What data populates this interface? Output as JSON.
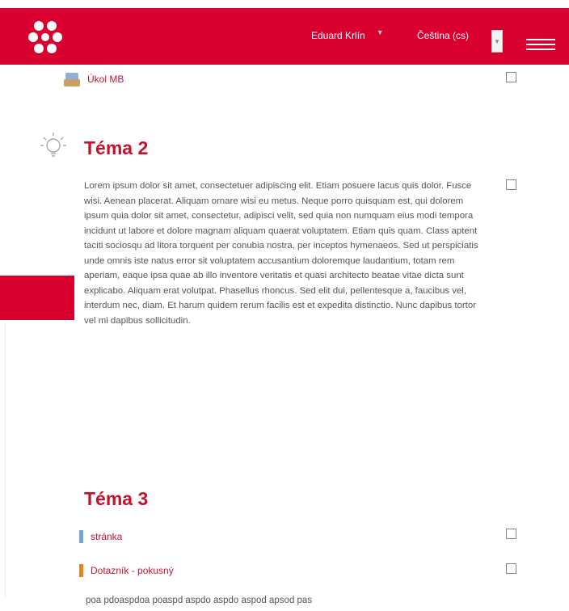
{
  "header": {
    "user_name": "Eduard Krlín",
    "language": "Čeština (cs)",
    "colors": {
      "brand": "#d9002f"
    }
  },
  "top_activity": {
    "label": "Úkol MB",
    "icon": "assignment-icon"
  },
  "sections": [
    {
      "title": "Téma 2",
      "icon": "lightbulb-icon",
      "summary": "Lorem ipsum dolor sit amet, consectetuer adipiscing elit. Etiam posuere lacus quis dolor. Fusce wisi. Aenean placerat. Aliquam ornare wisi eu metus. Neque porro quisquam est, qui dolorem ipsum quia dolor sit amet, consectetur, adipisci velit, sed quia non numquam eius modi tempora incidunt ut labore et dolore magnam aliquam quaerat voluptatem. Etiam quis quam. Class aptent taciti sociosqu ad litora torquent per conubia nostra, per inceptos hymenaeos. Sed ut perspiciatis unde omnis iste natus error sit voluptatem accusantium doloremque laudantium, totam rem aperiam, eaque ipsa quae ab illo inventore veritatis et quasi architecto beatae vitae dicta sunt explicabo. Aliquam erat volutpat. Phasellus rhoncus. Sed elit dui, pellentesque a, faucibus vel, interdum nec, diam. Et harum quidem rerum facilis est et expedita distinctio. Nunc dapibus tortor vel mi dapibus sollicitudin."
    },
    {
      "title": "Téma 3",
      "activities": [
        {
          "label": "stránka",
          "icon": "page-icon"
        },
        {
          "label": "Dotazník - pokusný",
          "icon": "questionnaire-icon"
        }
      ],
      "trailing_text": "poa pdoaspdoa poaspd aspdo aspdo aspod apsod pas"
    }
  ]
}
